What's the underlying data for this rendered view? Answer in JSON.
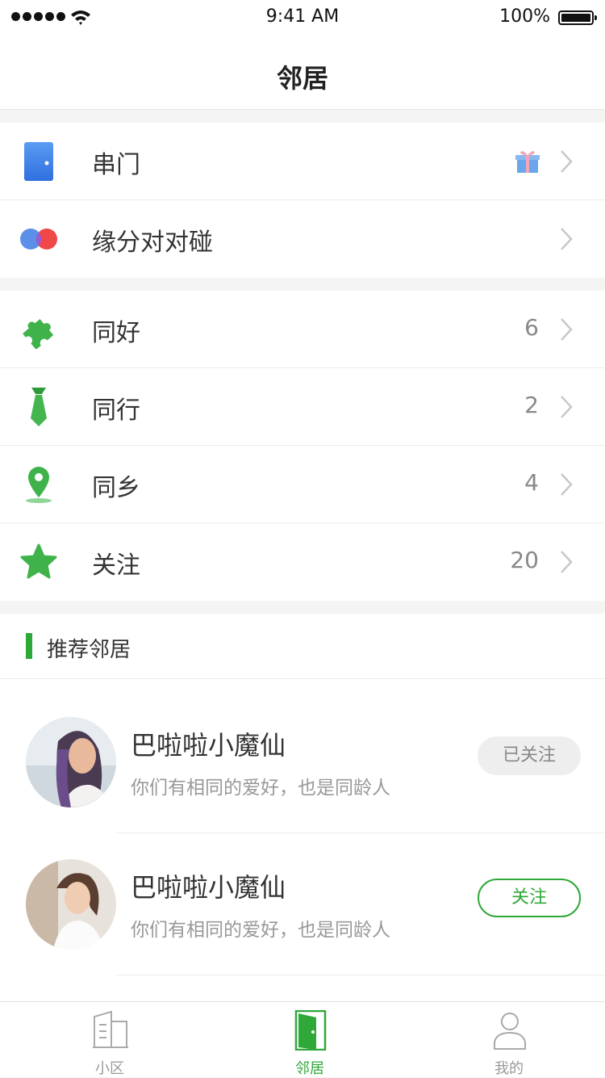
{
  "status_bar": {
    "time": "9:41 AM",
    "battery": "100%"
  },
  "nav": {
    "title": "邻居"
  },
  "menu_group_1": [
    {
      "label": "串门",
      "icon": "door-icon",
      "badge_icon": "gift-icon"
    },
    {
      "label": "缘分对对碰",
      "icon": "match-circles-icon"
    }
  ],
  "menu_group_2": [
    {
      "label": "同好",
      "count": "6",
      "icon": "puzzle-icon"
    },
    {
      "label": "同行",
      "count": "2",
      "icon": "tie-icon"
    },
    {
      "label": "同乡",
      "count": "4",
      "icon": "location-pin-icon"
    },
    {
      "label": "关注",
      "count": "20",
      "icon": "star-icon"
    }
  ],
  "recommend": {
    "title": "推荐邻居",
    "users": [
      {
        "name": "巴啦啦小魔仙",
        "desc": "你们有相同的爱好，也是同龄人",
        "button": "已关注",
        "followed": true
      },
      {
        "name": "巴啦啦小魔仙",
        "desc": "你们有相同的爱好，也是同龄人",
        "button": "关注",
        "followed": false
      }
    ]
  },
  "tabs": [
    {
      "label": "小区",
      "icon": "building-icon",
      "active": false
    },
    {
      "label": "邻居",
      "icon": "door-icon",
      "active": true
    },
    {
      "label": "我的",
      "icon": "user-icon",
      "active": false
    }
  ],
  "colors": {
    "accent": "#2fa83a",
    "door_blue": "#3b7be9",
    "match_red": "#f04848",
    "match_blue": "#5b8fe8"
  }
}
